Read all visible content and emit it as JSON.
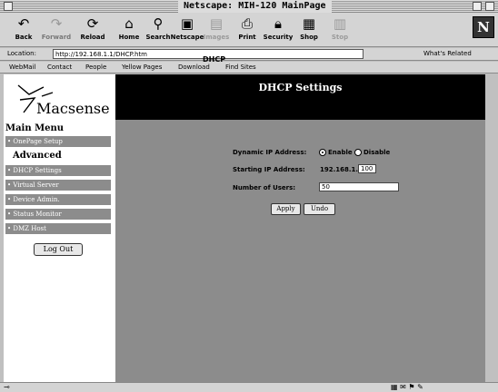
{
  "window": {
    "title": "Netscape: MIH-120 MainPage"
  },
  "toolbar": {
    "buttons": [
      {
        "label": "Back",
        "icon": "back-arrow"
      },
      {
        "label": "Forward",
        "icon": "forward-arrow"
      },
      {
        "label": "Reload",
        "icon": "reload"
      },
      {
        "label": "Home",
        "icon": "home"
      },
      {
        "label": "Search",
        "icon": "search"
      },
      {
        "label": "Netscape",
        "icon": "netscape"
      },
      {
        "label": "Images",
        "icon": "images"
      },
      {
        "label": "Print",
        "icon": "print"
      },
      {
        "label": "Security",
        "icon": "security"
      },
      {
        "label": "Shop",
        "icon": "shop"
      },
      {
        "label": "Stop",
        "icon": "stop"
      }
    ],
    "logo": "N"
  },
  "location": {
    "label": "Location:",
    "url": "http://192.168.1.1/DHCP.htm",
    "related": "What's Related"
  },
  "personal_bar": [
    "WebMail",
    "Contact",
    "People",
    "Yellow Pages",
    "Download",
    "Find Sites"
  ],
  "sidebar": {
    "brand": "acsense",
    "brand_mark": "M",
    "main_menu": "Main Menu",
    "onepage": "• OnePage Setup",
    "advanced": "Advanced",
    "items": [
      "• DHCP Settings",
      "• Virtual Server",
      "• Device Admin.",
      "• Status Monitor",
      "• DMZ Host"
    ],
    "logout": "Log Out"
  },
  "page": {
    "title": "DHCP Settings",
    "section": "DHCP",
    "dynamic_label": "Dynamic IP Address:",
    "enable": "Enable",
    "disable": "Disable",
    "start_label": "Starting IP Address:",
    "ip_prefix": "192.168.1.",
    "ip_last": "100",
    "users_label": "Number of Users:",
    "users_value": "50",
    "apply": "Apply",
    "undo": "Undo"
  }
}
